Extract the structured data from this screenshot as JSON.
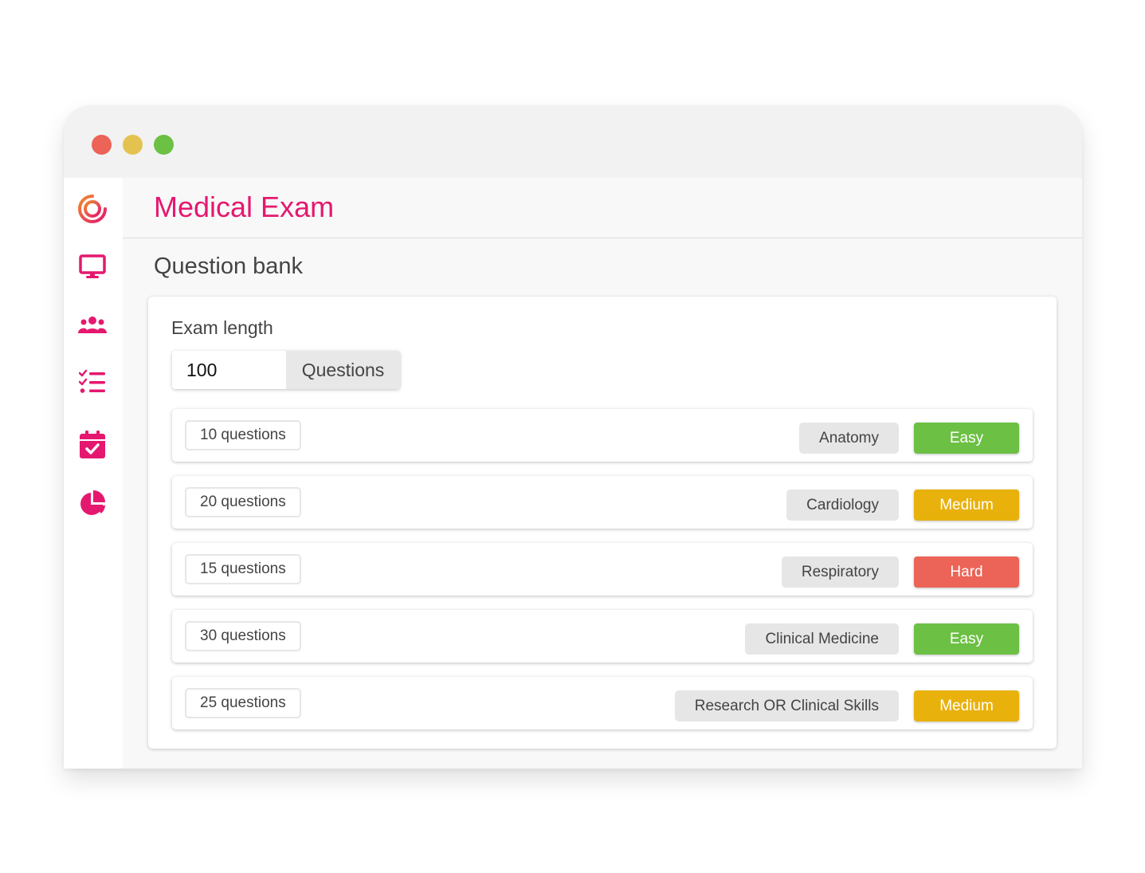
{
  "window": {
    "controls": [
      {
        "name": "close",
        "color": "#ec6357"
      },
      {
        "name": "minimize",
        "color": "#e3c24f"
      },
      {
        "name": "maximize",
        "color": "#6cc044"
      }
    ]
  },
  "sidebar": {
    "accent": "#e5186f",
    "items": [
      {
        "icon": "logo-icon"
      },
      {
        "icon": "monitor-icon"
      },
      {
        "icon": "users-icon"
      },
      {
        "icon": "checklist-icon"
      },
      {
        "icon": "calendar-check-icon"
      },
      {
        "icon": "pie-chart-icon"
      }
    ],
    "footer_icon": "user-avatar-icon"
  },
  "header": {
    "title": "Medical Exam"
  },
  "main": {
    "section_title": "Question bank",
    "exam_length": {
      "label": "Exam length",
      "value": "100",
      "unit": "Questions"
    },
    "topics": [
      {
        "count": "10 questions",
        "topic": "Anatomy",
        "level": "Easy",
        "level_color": "#6cc044"
      },
      {
        "count": "20 questions",
        "topic": "Cardiology",
        "level": "Medium",
        "level_color": "#e8b10c"
      },
      {
        "count": "15 questions",
        "topic": "Respiratory",
        "level": "Hard",
        "level_color": "#ec6357"
      },
      {
        "count": "30 questions",
        "topic": "Clinical Medicine",
        "level": "Easy",
        "level_color": "#6cc044"
      },
      {
        "count": "25 questions",
        "topic": "Research OR Clinical Skills",
        "level": "Medium",
        "level_color": "#e8b10c"
      }
    ]
  }
}
